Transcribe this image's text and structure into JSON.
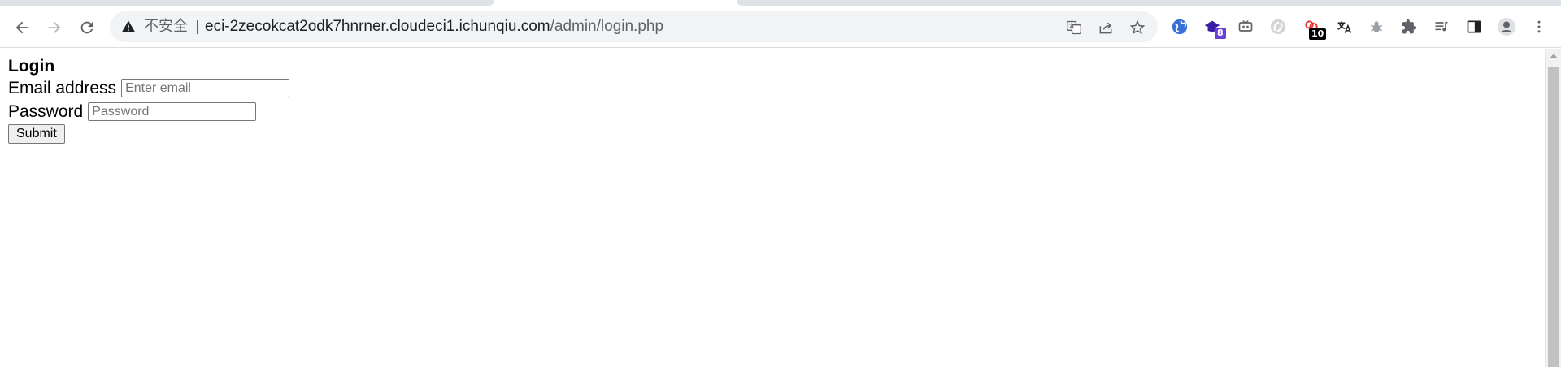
{
  "browser": {
    "back_icon": "arrow-left-icon",
    "forward_icon": "arrow-right-icon",
    "reload_icon": "reload-icon",
    "security_warning": "不安全",
    "url_host": "eci-2zecokcat2odk7hnrner.cloudeci1.ichunqiu.com",
    "url_path": "/admin/login.php",
    "extensions": {
      "badge_a": "8",
      "badge_b": "10"
    }
  },
  "page": {
    "title": "Login",
    "email_label": "Email address",
    "email_placeholder": "Enter email",
    "password_label": "Password",
    "password_placeholder": "Password",
    "submit_label": "Submit"
  }
}
